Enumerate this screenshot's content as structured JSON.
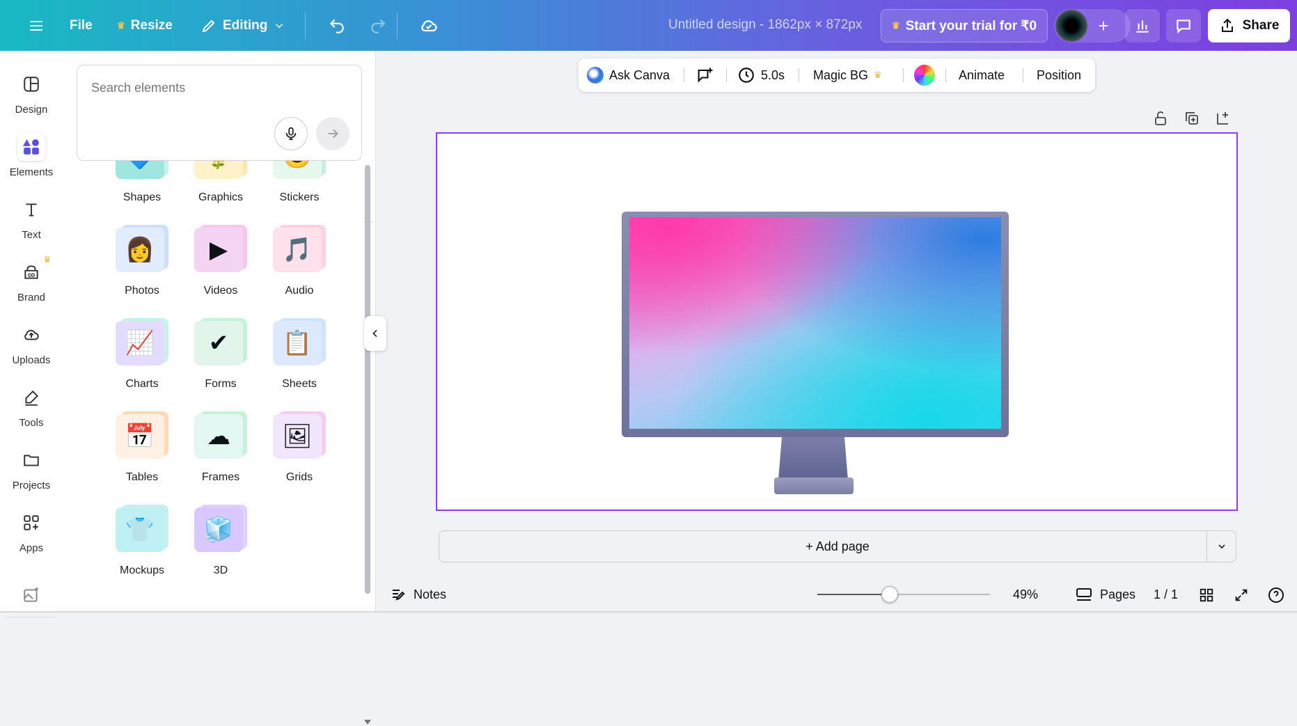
{
  "topbar": {
    "file_label": "File",
    "resize_label": "Resize",
    "editing_label": "Editing",
    "doc_title": "Untitled design - 1862px × 872px",
    "trial_label": "Start your trial for ₹0",
    "share_label": "Share",
    "brand_color": "#7d3fe0"
  },
  "rail": {
    "items": [
      {
        "label": "Design",
        "icon": "layout-icon"
      },
      {
        "label": "Elements",
        "icon": "shapes-icon"
      },
      {
        "label": "Text",
        "icon": "text-icon"
      },
      {
        "label": "Brand",
        "icon": "brand-icon"
      },
      {
        "label": "Uploads",
        "icon": "cloud-upload-icon"
      },
      {
        "label": "Tools",
        "icon": "pen-icon"
      },
      {
        "label": "Projects",
        "icon": "folder-icon"
      },
      {
        "label": "Apps",
        "icon": "apps-icon"
      }
    ],
    "active": "Elements"
  },
  "panel": {
    "search_placeholder": "Search elements",
    "categories": [
      {
        "label": "Shapes",
        "emoji": "🔷"
      },
      {
        "label": "Graphics",
        "emoji": "🌻"
      },
      {
        "label": "Stickers",
        "emoji": "😊"
      },
      {
        "label": "Photos",
        "emoji": "👩"
      },
      {
        "label": "Videos",
        "emoji": "▶"
      },
      {
        "label": "Audio",
        "emoji": "🎵"
      },
      {
        "label": "Charts",
        "emoji": "📈"
      },
      {
        "label": "Forms",
        "emoji": "✔"
      },
      {
        "label": "Sheets",
        "emoji": "📋"
      },
      {
        "label": "Tables",
        "emoji": "📅"
      },
      {
        "label": "Frames",
        "emoji": "☁"
      },
      {
        "label": "Grids",
        "emoji": "🖼"
      },
      {
        "label": "Mockups",
        "emoji": "👕"
      },
      {
        "label": "3D",
        "emoji": "🧊"
      }
    ]
  },
  "context_toolbar": {
    "ask_canva": "Ask Canva",
    "duration": "5.0s",
    "magic_bg": "Magic BG",
    "animate": "Animate",
    "position": "Position"
  },
  "canvas": {
    "add_page": "+ Add page"
  },
  "bottom_bar": {
    "notes": "Notes",
    "zoom": "49%",
    "zoom_fraction": 0.49,
    "pages": "Pages",
    "page_count": "1 / 1"
  }
}
